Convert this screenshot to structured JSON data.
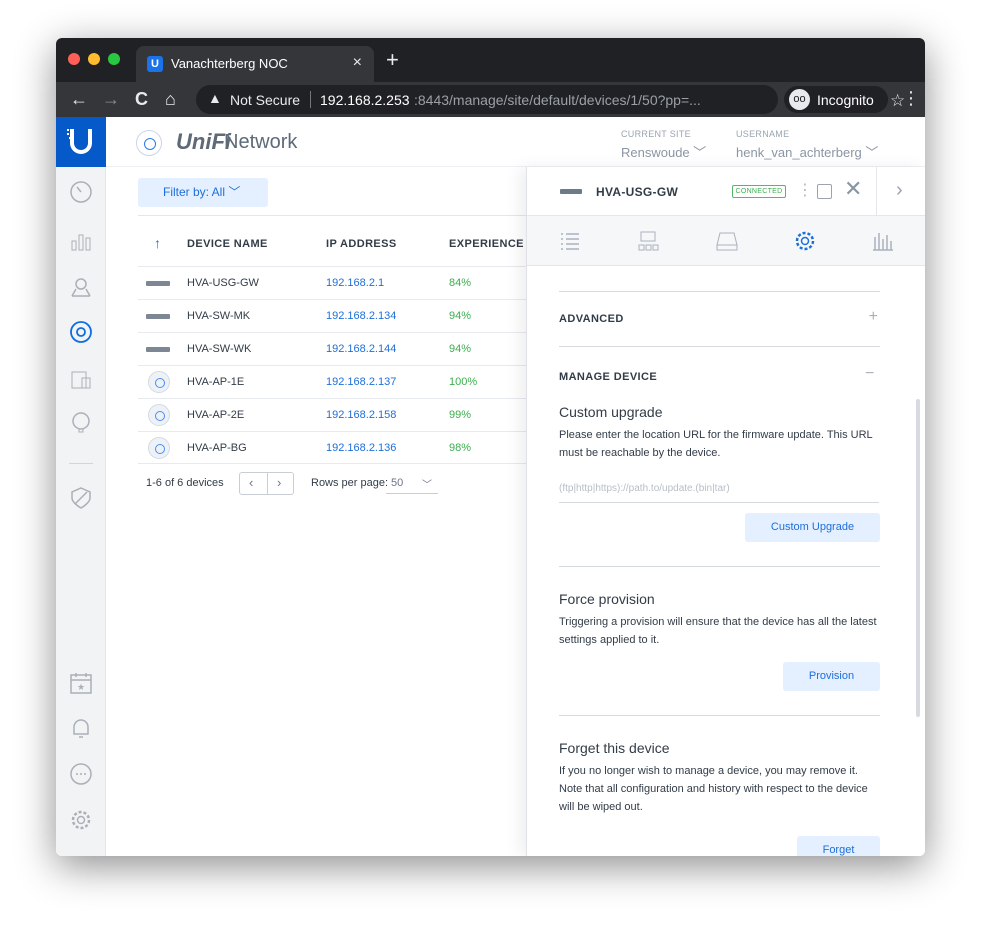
{
  "browser": {
    "tab_title": "Vanachterberg NOC",
    "tab_favicon": "U",
    "tab_close": "×",
    "new_tab": "+",
    "back": "←",
    "forward": "→",
    "reload": "C",
    "home": "⌂",
    "security_icon": "▲",
    "security_label": "Not Secure",
    "url_host": "192.168.2.253",
    "url_path": ":8443/manage/site/default/devices/1/50?pp=...",
    "bookmark_star": "☆",
    "incognito_label": "Incognito",
    "incognito_icon": "oo",
    "menu": "⋮"
  },
  "app": {
    "brand_unifi": "UniFi",
    "brand_network": "Network",
    "current_site_label": "CURRENT SITE",
    "current_site_value": "Renswoude",
    "username_label": "USERNAME",
    "username_value": "henk_van_achterberg"
  },
  "nav_icons": [
    "dashboard-icon",
    "statistics-icon",
    "map-icon",
    "devices-icon",
    "clients-icon",
    "insights-icon",
    "threat-management-icon",
    "events-icon",
    "alerts-icon",
    "chat-icon",
    "settings-icon"
  ],
  "filter": {
    "label": "Filter by: All"
  },
  "table": {
    "sort_arrow": "↑",
    "columns": [
      "DEVICE NAME",
      "IP ADDRESS",
      "EXPERIENCE"
    ],
    "rows": [
      {
        "type": "gateway",
        "name": "HVA-USG-GW",
        "ip": "192.168.2.1",
        "experience": "84%"
      },
      {
        "type": "switch",
        "name": "HVA-SW-MK",
        "ip": "192.168.2.134",
        "experience": "94%"
      },
      {
        "type": "switch",
        "name": "HVA-SW-WK",
        "ip": "192.168.2.144",
        "experience": "94%"
      },
      {
        "type": "ap",
        "name": "HVA-AP-1E",
        "ip": "192.168.2.137",
        "experience": "100%"
      },
      {
        "type": "ap",
        "name": "HVA-AP-2E",
        "ip": "192.168.2.158",
        "experience": "99%"
      },
      {
        "type": "ap",
        "name": "HVA-AP-BG",
        "ip": "192.168.2.136",
        "experience": "98%"
      }
    ],
    "pager_text": "1-6 of 6 devices",
    "prev": "‹",
    "next": "›",
    "rows_per_page_label": "Rows per page:",
    "rows_per_page_value": "50"
  },
  "panel": {
    "device_name": "HVA-USG-GW",
    "status": "CONNECTED",
    "tabs": [
      "details-icon",
      "topology-icon",
      "ports-icon",
      "config-icon",
      "stats-icon"
    ],
    "sections": {
      "advanced": {
        "title": "ADVANCED",
        "toggle": "+"
      },
      "manage": {
        "title": "MANAGE DEVICE",
        "toggle": "−"
      }
    },
    "custom_upgrade": {
      "title": "Custom upgrade",
      "description": "Please enter the location URL for the firmware update. This URL must be reachable by the device.",
      "placeholder": "(ftp|http|https)://path.to/update.(bin|tar)",
      "button": "Custom Upgrade"
    },
    "force_provision": {
      "title": "Force provision",
      "description": "Triggering a provision will ensure that the device has all the latest settings applied to it.",
      "button": "Provision"
    },
    "forget": {
      "title": "Forget this device",
      "description": "If you no longer wish to manage a device, you may remove it. Note that all configuration and history with respect to the device will be wiped out.",
      "button": "Forget"
    }
  }
}
